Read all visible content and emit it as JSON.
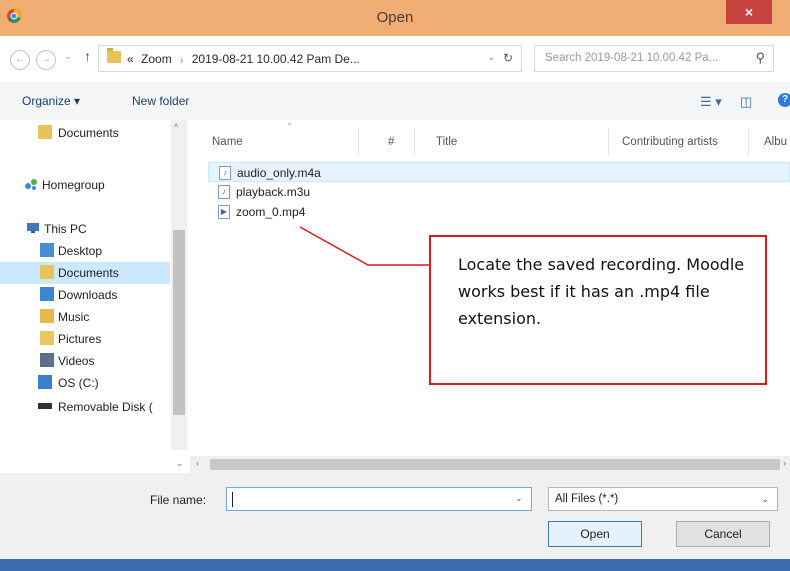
{
  "window": {
    "title": "Open",
    "close_glyph": "×"
  },
  "nav": {
    "back_glyph": "←",
    "forward_glyph": "→",
    "dropdown_glyph": "⌄",
    "up_glyph": "↑"
  },
  "address": {
    "overflow": "«",
    "crumb1": "Zoom",
    "crumb_sep": "›",
    "crumb2": "2019-08-21 10.00.42 Pam De...",
    "dropdown_glyph": "⌄",
    "refresh_glyph": "↻"
  },
  "search": {
    "placeholder": "Search 2019-08-21 10.00.42 Pa...",
    "icon_glyph": "⚲"
  },
  "toolbar": {
    "organize_label": "Organize ▾",
    "new_folder_label": "New folder",
    "view_glyph": "☰ ▾",
    "pane_glyph": "◫",
    "help_glyph": "?"
  },
  "sidebar": {
    "items": [
      {
        "label": "Documents",
        "icon": "folder-icon"
      },
      {
        "label": "Homegroup",
        "icon": "homegroup-icon"
      },
      {
        "label": "This PC",
        "icon": "computer-icon"
      },
      {
        "label": "Desktop",
        "icon": "desktop-icon"
      },
      {
        "label": "Documents",
        "icon": "documents-icon"
      },
      {
        "label": "Downloads",
        "icon": "downloads-icon"
      },
      {
        "label": "Music",
        "icon": "music-icon"
      },
      {
        "label": "Pictures",
        "icon": "pictures-icon"
      },
      {
        "label": "Videos",
        "icon": "videos-icon"
      },
      {
        "label": "OS (C:)",
        "icon": "drive-icon"
      },
      {
        "label": "Removable Disk (",
        "icon": "removable-disk-icon"
      }
    ],
    "scroll_up_glyph": "^",
    "scroll_down_glyph": "⌄"
  },
  "file_list": {
    "columns": [
      "Name",
      "#",
      "Title",
      "Contributing artists",
      "Albu"
    ],
    "files": [
      {
        "name": "audio_only.m4a",
        "icon": "audio-file-icon",
        "selected": true
      },
      {
        "name": "playback.m3u",
        "icon": "playlist-file-icon",
        "selected": false
      },
      {
        "name": "zoom_0.mp4",
        "icon": "video-file-icon",
        "selected": false
      }
    ],
    "hscroll_left_glyph": "‹",
    "hscroll_right_glyph": "›"
  },
  "bottom": {
    "file_name_label": "File name:",
    "file_name_value": "",
    "file_name_dropdown_glyph": "⌄",
    "filter_value": "All Files (*.*)",
    "filter_dropdown_glyph": "⌄",
    "open_label": "Open",
    "cancel_label": "Cancel"
  },
  "callout": {
    "text": "Locate the saved recording. Moodle works best if it has an .mp4 file extension."
  },
  "colors": {
    "titlebar": "#f1ae74",
    "close": "#c74340",
    "callout_border": "#d91c1c",
    "selection": "#cce8ff"
  }
}
